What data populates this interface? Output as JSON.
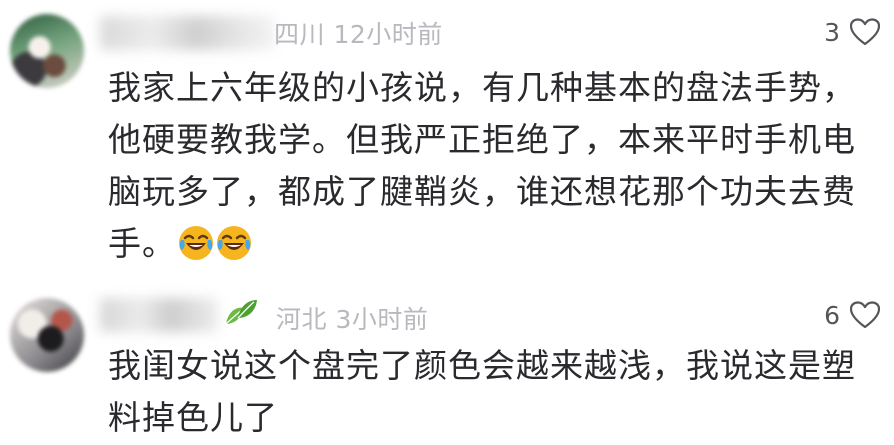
{
  "comments": [
    {
      "location_time": "四川 12小时前",
      "likes": "3",
      "text": "我家上六年级的小孩说，有几种基本的盘法手势，他硬要教我学。但我严正拒绝了，本来平时手机电脑玩多了，都成了腱鞘炎，谁还想花那个功夫去费手。",
      "emoji_names": [
        "crying-laughing-icon",
        "crying-laughing-icon"
      ]
    },
    {
      "location_time": "河北 3小时前",
      "likes": "6",
      "text": "我闺女说这个盘完了颜色会越来越浅，我说这是塑料掉色儿了",
      "badge_icon": "leaf-icon"
    }
  ],
  "colors": {
    "meta_text": "#b8b8be",
    "body_text": "#2a2a2e",
    "leaf_green": "#5fae3c",
    "emoji_yellow": "#f6b51e"
  }
}
